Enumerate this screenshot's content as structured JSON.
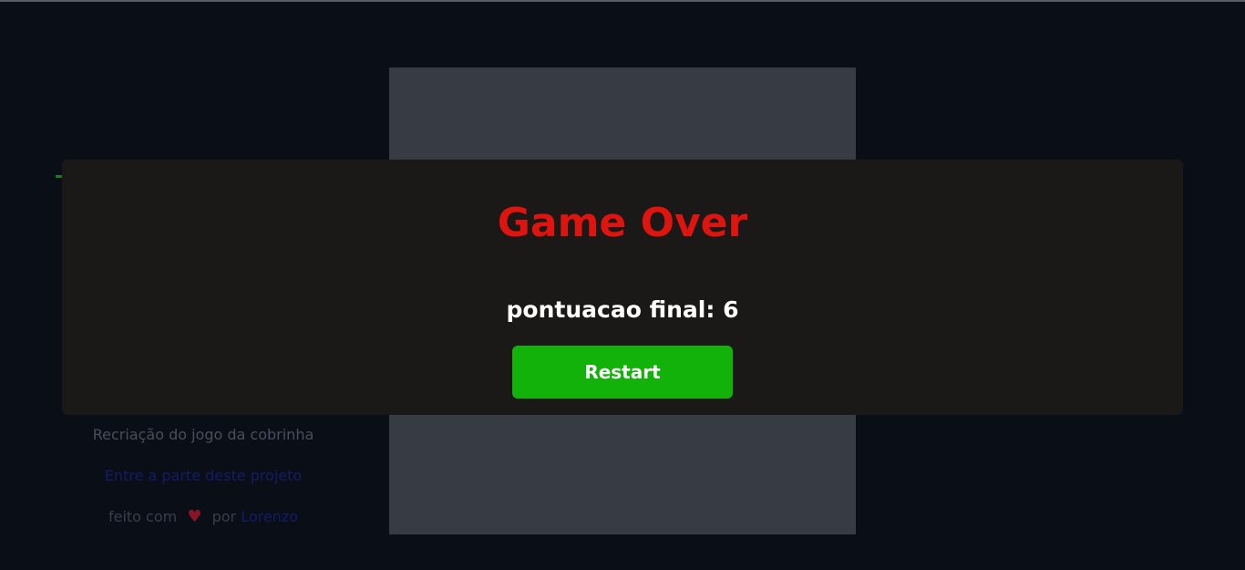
{
  "game": {
    "overlay_title": "Game Over",
    "score_label": "pontuacao final:",
    "score_value": "6",
    "restart_label": "Restart"
  },
  "info": {
    "description": "Recriação do jogo da cobrinha",
    "link_text": "Entre a parte deste projeto",
    "credit_prefix": "feito com",
    "heart_icon": "heart-icon",
    "credit_by": "por",
    "author": "Lorenzo"
  },
  "colors": {
    "background": "#0a0e17",
    "board": "#373b44",
    "overlay": "#1b1917",
    "title": "#e0140f",
    "button": "#12b20a",
    "heart": "#8a1424",
    "link": "#141c66"
  }
}
